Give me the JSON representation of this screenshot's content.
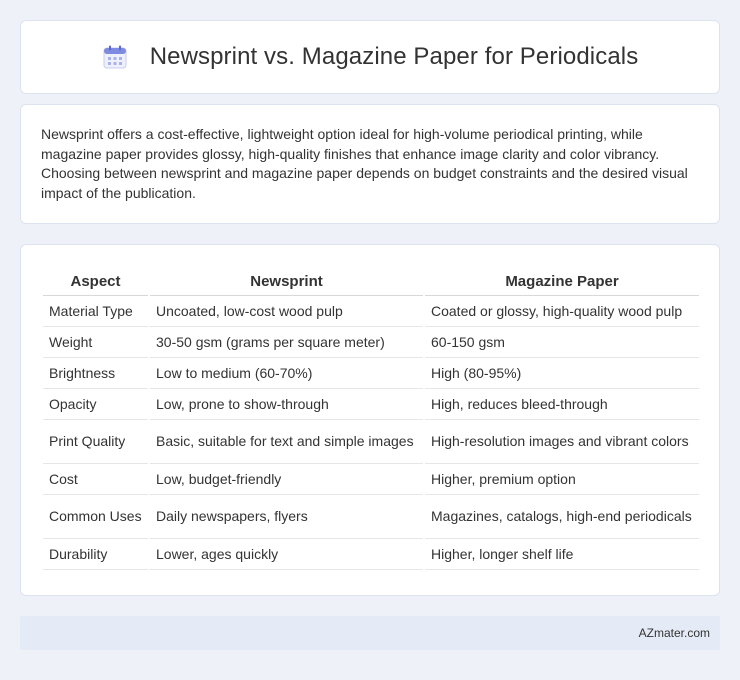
{
  "header": {
    "title": "Newsprint vs. Magazine Paper for Periodicals",
    "icon": "calendar-icon"
  },
  "description": "Newsprint offers a cost-effective, lightweight option ideal for high-volume periodical printing, while magazine paper provides glossy, high-quality finishes that enhance image clarity and color vibrancy. Choosing between newsprint and magazine paper depends on budget constraints and the desired visual impact of the publication.",
  "table": {
    "headers": [
      "Aspect",
      "Newsprint",
      "Magazine Paper"
    ],
    "rows": [
      [
        "Material Type",
        "Uncoated, low-cost wood pulp",
        "Coated or glossy, high-quality wood pulp"
      ],
      [
        "Weight",
        "30-50 gsm (grams per square meter)",
        "60-150 gsm"
      ],
      [
        "Brightness",
        "Low to medium (60-70%)",
        "High (80-95%)"
      ],
      [
        "Opacity",
        "Low, prone to show-through",
        "High, reduces bleed-through"
      ],
      [
        "Print Quality",
        "Basic, suitable for text and simple images",
        "High-resolution images and vibrant colors"
      ],
      [
        "Cost",
        "Low, budget-friendly",
        "Higher, premium option"
      ],
      [
        "Common Uses",
        "Daily newspapers, flyers",
        "Magazines, catalogs, high-end periodicals"
      ],
      [
        "Durability",
        "Lower, ages quickly",
        "Higher, longer shelf life"
      ]
    ]
  },
  "footer": {
    "text": "AZmater.com"
  },
  "colors": {
    "background": "#eef2f8",
    "card": "#ffffff",
    "footer": "#e4ebf6",
    "icon_accent": "#6a79d8"
  }
}
